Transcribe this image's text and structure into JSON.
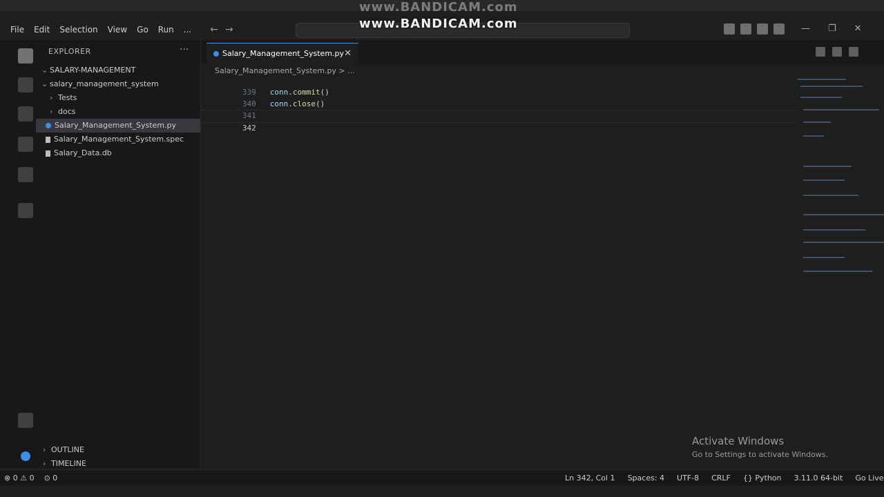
{
  "watermark": "www.BANDICAM.com",
  "menu": [
    "File",
    "Edit",
    "Selection",
    "View",
    "Go",
    "Run",
    "..."
  ],
  "search": {
    "placeholder": ""
  },
  "sidebar": {
    "header": "EXPLORER",
    "root": "SALARY-MANAGEMENT",
    "items": [
      {
        "label": "salary_management_system",
        "type": "folder"
      },
      {
        "label": "Tests",
        "type": "folder"
      },
      {
        "label": "docs",
        "type": "folder"
      },
      {
        "label": "Salary_Management_System.py",
        "type": "py",
        "selected": true
      },
      {
        "label": "Salary_Management_System.spec",
        "type": "file"
      },
      {
        "label": "Salary_Data.db",
        "type": "file"
      }
    ],
    "bottom": [
      "OUTLINE",
      "TIMELINE"
    ]
  },
  "editor": {
    "tab_label": "Salary_Management_System.py",
    "breadcrumb": "Salary_Management_System.py > ...",
    "lines": [
      {
        "num": "339",
        "code_var": "conn",
        "code_fn": "commit",
        "code_tail": "()"
      },
      {
        "num": "340",
        "code_var": "conn",
        "code_fn": "close",
        "code_tail": "()"
      },
      {
        "num": "341",
        "code_var": "",
        "code_fn": "",
        "code_tail": ""
      },
      {
        "num": "342",
        "code_var": "",
        "code_fn": "",
        "code_tail": ""
      }
    ]
  },
  "activate": {
    "title": "Activate Windows",
    "subtitle": "Go to Settings to activate Windows."
  },
  "status": {
    "left": [
      "⊗ 0 ⚠ 0",
      "⊙ 0"
    ],
    "position": "Ln 342, Col 1",
    "spaces": "Spaces: 4",
    "encoding": "UTF-8",
    "eol": "CRLF",
    "language": "{} Python",
    "version": "3.11.0 64-bit",
    "live": "Go Live"
  }
}
